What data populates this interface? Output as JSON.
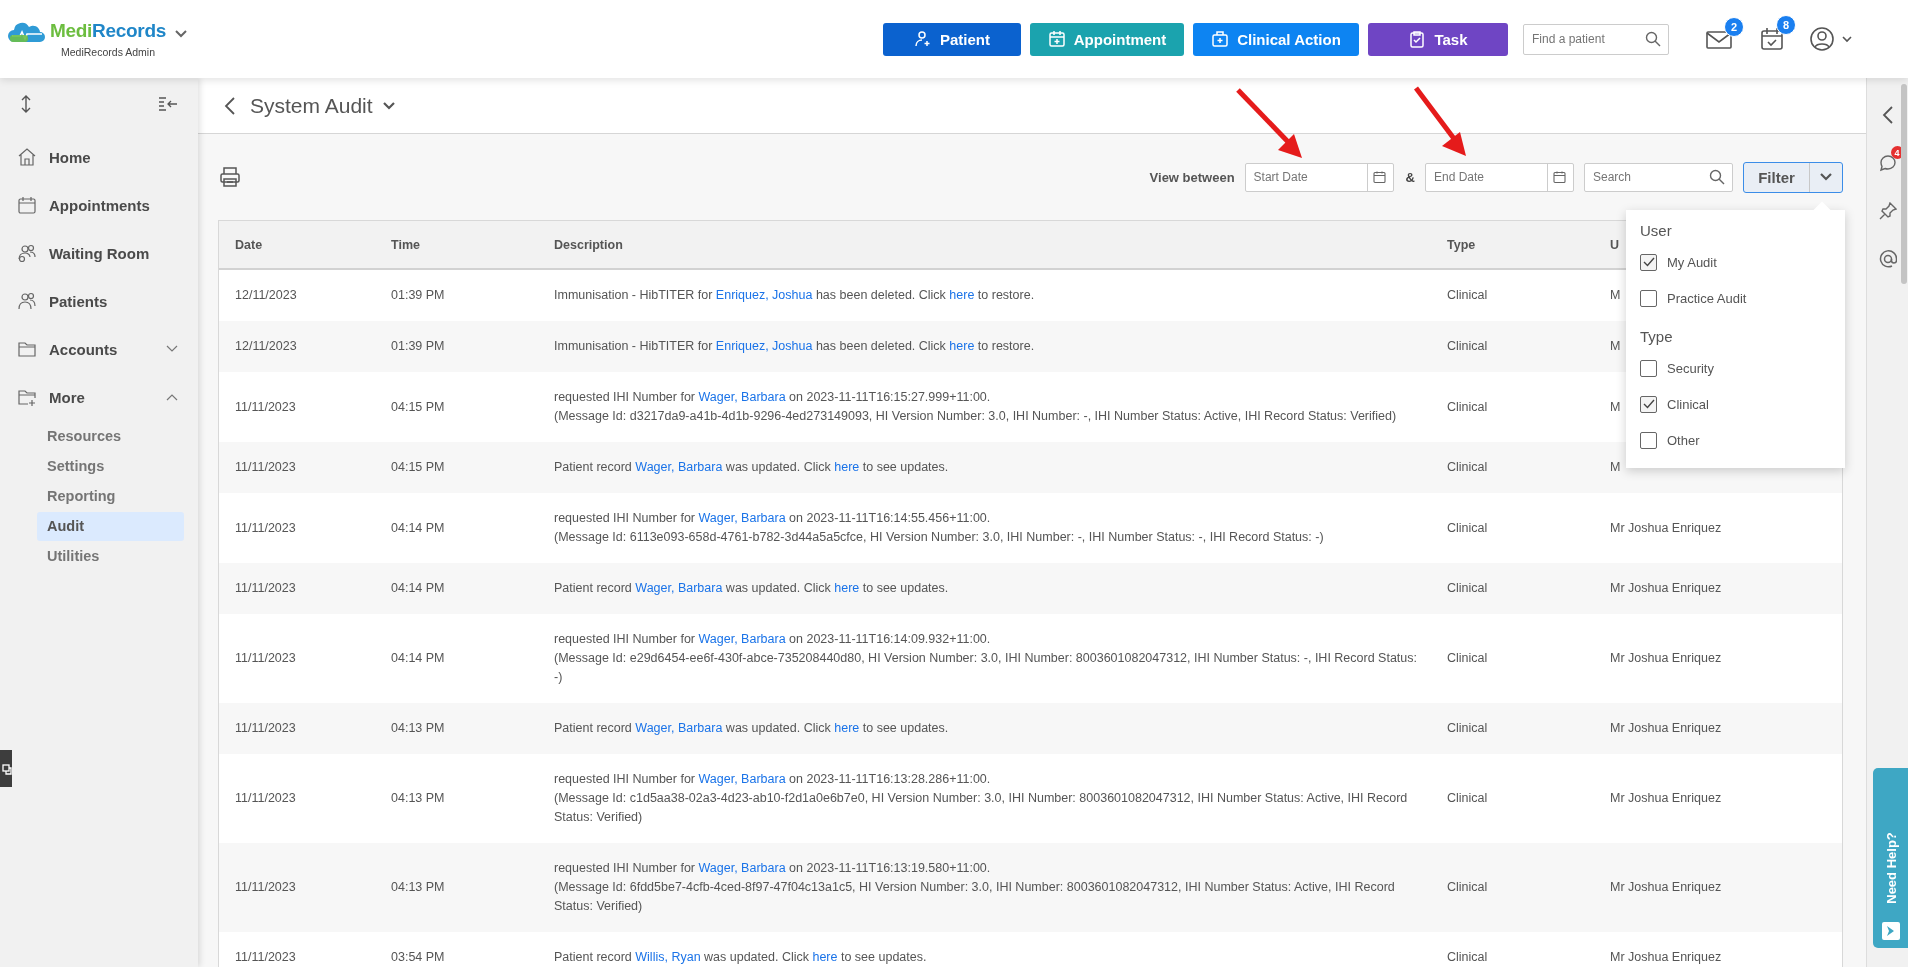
{
  "header": {
    "brand_parts": [
      "Medi",
      "Records"
    ],
    "org": "MediRecords Admin",
    "actions": [
      {
        "label": "Patient",
        "kind": "patient",
        "color": "#0b62cf"
      },
      {
        "label": "Appointment",
        "kind": "appointment",
        "color": "#1ba3ae"
      },
      {
        "label": "Clinical Action",
        "kind": "clinical",
        "color": "#0d84f2"
      },
      {
        "label": "Task",
        "kind": "task",
        "color": "#6f45c4"
      }
    ],
    "search": {
      "placeholder": "Find a patient"
    },
    "mail_count": "2",
    "tasks_count": "8"
  },
  "sidebar": {
    "items": [
      {
        "label": "Home",
        "kind": "home",
        "selected": false
      },
      {
        "label": "Appointments",
        "kind": "calendar",
        "selected": false
      },
      {
        "label": "Waiting Room",
        "kind": "waiting",
        "selected": false
      },
      {
        "label": "Patients",
        "kind": "people",
        "selected": false
      },
      {
        "label": "Accounts",
        "kind": "folder",
        "selected": false,
        "expanded": false
      },
      {
        "label": "More",
        "kind": "folderplus",
        "selected": false,
        "expanded": true,
        "children": [
          {
            "label": "Resources",
            "selected": false
          },
          {
            "label": "Settings",
            "selected": false
          },
          {
            "label": "Reporting",
            "selected": false
          },
          {
            "label": "Audit",
            "selected": true
          },
          {
            "label": "Utilities",
            "selected": false
          }
        ]
      }
    ]
  },
  "page": {
    "title": "System Audit"
  },
  "toolbar": {
    "view_label": "View between",
    "start_date": {
      "placeholder": "Start Date"
    },
    "separator": "&",
    "end_date": {
      "placeholder": "End Date"
    },
    "search": {
      "placeholder": "Search"
    },
    "filter_label": "Filter"
  },
  "filter_menu": {
    "groups": [
      {
        "title": "User",
        "options": [
          {
            "label": "My Audit",
            "checked": true
          },
          {
            "label": "Practice Audit",
            "checked": false
          }
        ]
      },
      {
        "title": "Type",
        "options": [
          {
            "label": "Security",
            "checked": false
          },
          {
            "label": "Clinical",
            "checked": true
          },
          {
            "label": "Other",
            "checked": false
          }
        ]
      }
    ]
  },
  "table": {
    "columns": [
      "Date",
      "Time",
      "Description",
      "Type",
      "U"
    ],
    "rows": [
      {
        "date": "12/11/2023",
        "time": "01:39 PM",
        "description": [
          {
            "kind": "text",
            "text": "Immunisation - HibTITER for "
          },
          {
            "kind": "link",
            "text": "Enriquez, Joshua"
          },
          {
            "kind": "text",
            "text": " has been deleted. Click "
          },
          {
            "kind": "link",
            "text": "here"
          },
          {
            "kind": "text",
            "text": " to restore."
          }
        ],
        "type": "Clinical",
        "user": "M"
      },
      {
        "date": "12/11/2023",
        "time": "01:39 PM",
        "description": [
          {
            "kind": "text",
            "text": "Immunisation - HibTITER for "
          },
          {
            "kind": "link",
            "text": "Enriquez, Joshua"
          },
          {
            "kind": "text",
            "text": " has been deleted. Click "
          },
          {
            "kind": "link",
            "text": "here"
          },
          {
            "kind": "text",
            "text": " to restore."
          }
        ],
        "type": "Clinical",
        "user": "M"
      },
      {
        "date": "11/11/2023",
        "time": "04:15 PM",
        "description": [
          {
            "kind": "text",
            "text": "requested IHI Number for "
          },
          {
            "kind": "link",
            "text": "Wager, Barbara"
          },
          {
            "kind": "text",
            "text": " on 2023-11-11T16:15:27.999+11:00."
          }
        ],
        "details": "(Message Id: d3217da9-a41b-4d1b-9296-4ed273149093, HI Version Number: 3.0, IHI Number: -, IHI Number Status: Active, IHI Record Status: Verified)",
        "type": "Clinical",
        "user": "M"
      },
      {
        "date": "11/11/2023",
        "time": "04:15 PM",
        "description": [
          {
            "kind": "text",
            "text": "Patient record "
          },
          {
            "kind": "link",
            "text": "Wager, Barbara"
          },
          {
            "kind": "text",
            "text": " was updated. Click "
          },
          {
            "kind": "link",
            "text": "here"
          },
          {
            "kind": "text",
            "text": " to see updates."
          }
        ],
        "type": "Clinical",
        "user": "M"
      },
      {
        "date": "11/11/2023",
        "time": "04:14 PM",
        "description": [
          {
            "kind": "text",
            "text": "requested IHI Number for "
          },
          {
            "kind": "link",
            "text": "Wager, Barbara"
          },
          {
            "kind": "text",
            "text": " on 2023-11-11T16:14:55.456+11:00."
          }
        ],
        "details": "(Message Id: 6113e093-658d-4761-b782-3d44a5a5cfce, HI Version Number: 3.0, IHI Number: -, IHI Number Status: -, IHI Record Status: -)",
        "type": "Clinical",
        "user": "Mr Joshua Enriquez"
      },
      {
        "date": "11/11/2023",
        "time": "04:14 PM",
        "description": [
          {
            "kind": "text",
            "text": "Patient record "
          },
          {
            "kind": "link",
            "text": "Wager, Barbara"
          },
          {
            "kind": "text",
            "text": " was updated. Click "
          },
          {
            "kind": "link",
            "text": "here"
          },
          {
            "kind": "text",
            "text": " to see updates."
          }
        ],
        "type": "Clinical",
        "user": "Mr Joshua Enriquez"
      },
      {
        "date": "11/11/2023",
        "time": "04:14 PM",
        "description": [
          {
            "kind": "text",
            "text": "requested IHI Number for "
          },
          {
            "kind": "link",
            "text": "Wager, Barbara"
          },
          {
            "kind": "text",
            "text": " on 2023-11-11T16:14:09.932+11:00."
          }
        ],
        "details": "(Message Id: e29d6454-ee6f-430f-abce-735208440d80, HI Version Number: 3.0, IHI Number: 8003601082047312, IHI Number Status: -, IHI Record Status: -)",
        "type": "Clinical",
        "user": "Mr Joshua Enriquez"
      },
      {
        "date": "11/11/2023",
        "time": "04:13 PM",
        "description": [
          {
            "kind": "text",
            "text": "Patient record "
          },
          {
            "kind": "link",
            "text": "Wager, Barbara"
          },
          {
            "kind": "text",
            "text": " was updated. Click "
          },
          {
            "kind": "link",
            "text": "here"
          },
          {
            "kind": "text",
            "text": " to see updates."
          }
        ],
        "type": "Clinical",
        "user": "Mr Joshua Enriquez"
      },
      {
        "date": "11/11/2023",
        "time": "04:13 PM",
        "description": [
          {
            "kind": "text",
            "text": "requested IHI Number for "
          },
          {
            "kind": "link",
            "text": "Wager, Barbara"
          },
          {
            "kind": "text",
            "text": " on 2023-11-11T16:13:28.286+11:00."
          }
        ],
        "details": "(Message Id: c1d5aa38-02a3-4d23-ab10-f2d1a0e6b7e0, HI Version Number: 3.0, IHI Number: 8003601082047312, IHI Number Status: Active, IHI Record Status: Verified)",
        "type": "Clinical",
        "user": "Mr Joshua Enriquez"
      },
      {
        "date": "11/11/2023",
        "time": "04:13 PM",
        "description": [
          {
            "kind": "text",
            "text": "requested IHI Number for "
          },
          {
            "kind": "link",
            "text": "Wager, Barbara"
          },
          {
            "kind": "text",
            "text": " on 2023-11-11T16:13:19.580+11:00."
          }
        ],
        "details": "(Message Id: 6fdd5be7-4cfb-4ced-8f97-47f04c13a1c5, HI Version Number: 3.0, IHI Number: 8003601082047312, IHI Number Status: Active, IHI Record Status: Verified)",
        "type": "Clinical",
        "user": "Mr Joshua Enriquez"
      },
      {
        "date": "11/11/2023",
        "time": "03:54 PM",
        "description": [
          {
            "kind": "text",
            "text": "Patient record "
          },
          {
            "kind": "link",
            "text": "Willis, Ryan"
          },
          {
            "kind": "text",
            "text": " was updated. Click "
          },
          {
            "kind": "link",
            "text": "here"
          },
          {
            "kind": "text",
            "text": " to see updates."
          }
        ],
        "type": "Clinical",
        "user": "Mr Joshua Enriquez"
      }
    ]
  },
  "rail": {
    "chat_count": "4"
  },
  "help": {
    "label": "Need Help?"
  }
}
